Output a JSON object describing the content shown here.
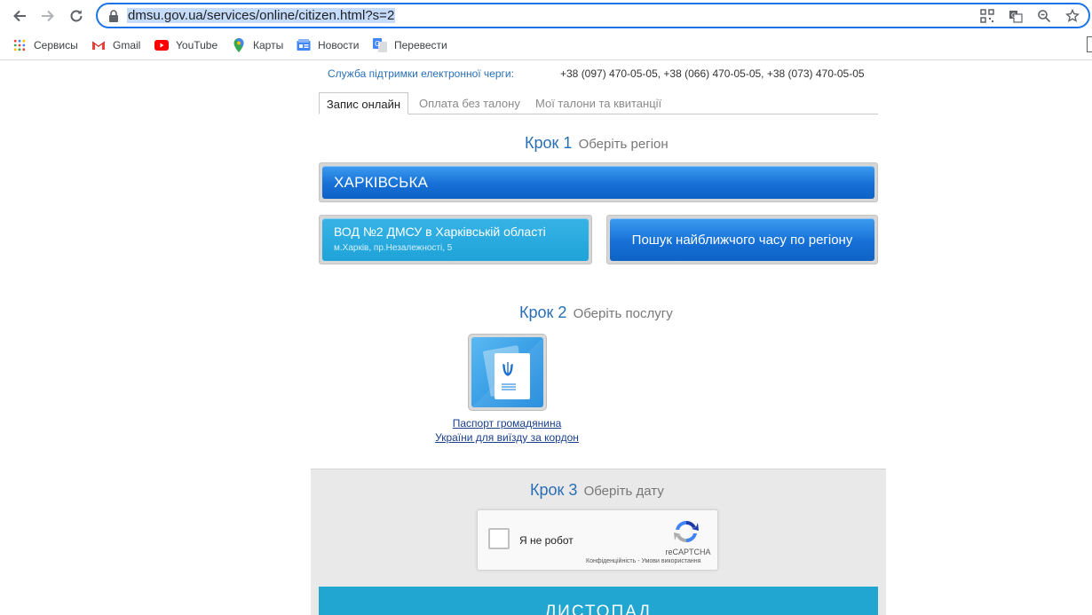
{
  "browser": {
    "url": "dmsu.gov.ua/services/online/citizen.html?s=2",
    "bookmarks": [
      {
        "label": "Сервисы",
        "icon": "apps-grid-icon"
      },
      {
        "label": "Gmail",
        "icon": "gmail-icon"
      },
      {
        "label": "YouTube",
        "icon": "youtube-icon"
      },
      {
        "label": "Карты",
        "icon": "maps-pin-icon"
      },
      {
        "label": "Новости",
        "icon": "news-icon"
      },
      {
        "label": "Перевести",
        "icon": "translate-icon"
      }
    ]
  },
  "support": {
    "label": "Служба підтримки електронної черги:",
    "phones": "+38 (097) 470-05-05, +38 (066) 470-05-05, +38 (073) 470-05-05"
  },
  "tabs": [
    "Запис онлайн",
    "Оплата без талону",
    "Мої талони та квитанції"
  ],
  "step1": {
    "num": "Крок 1",
    "title": "Оберіть регіон",
    "region": "ХАРКІВСЬКА",
    "office_name": "ВОД №2 ДМСУ в Харківській області",
    "office_address": "м.Харків, пр.Незалежності, 5",
    "search_button": "Пошук найближчого часу по регіону"
  },
  "step2": {
    "num": "Крок 2",
    "title": "Оберіть послугу",
    "service_line1": "Паспорт громадянина",
    "service_line2": "України для виїзду за кордон"
  },
  "step3": {
    "num": "Крок 3",
    "title": "Оберіть дату",
    "captcha_label": "Я не робот",
    "captcha_brand": "reCAPTCHA",
    "captcha_terms": "Конфіденційність - Умови використання",
    "month": "ЛИСТОПАД"
  },
  "colors": {
    "accent_blue": "#1670d6",
    "link_blue": "#2a6fb5",
    "month_bar": "#20a6d0"
  }
}
